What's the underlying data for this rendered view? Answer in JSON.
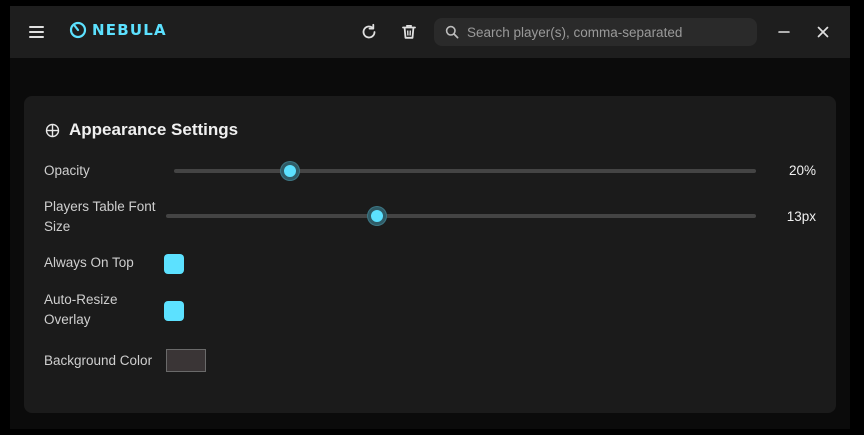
{
  "app": {
    "name": "NEBULA",
    "accent_color": "#5ce1ff"
  },
  "toolbar": {
    "menu_icon": "hamburger-menu-icon",
    "refresh_icon": "refresh-icon",
    "trash_icon": "trash-icon",
    "minimize_icon": "minimize-icon",
    "close_icon": "close-icon"
  },
  "search": {
    "placeholder": "Search player(s), comma-separated",
    "value": ""
  },
  "settings": {
    "title": "Appearance Settings",
    "opacity": {
      "label": "Opacity",
      "value": 20,
      "display": "20%",
      "min": 0,
      "max": 100
    },
    "font_size": {
      "label": "Players Table Font Size",
      "value": 13,
      "display": "13px",
      "min": 8,
      "max": 22
    },
    "always_on_top": {
      "label": "Always On Top",
      "checked": true
    },
    "auto_resize": {
      "label": "Auto-Resize Overlay",
      "checked": true
    },
    "background_color": {
      "label": "Background Color",
      "value": "#3a3536"
    }
  }
}
